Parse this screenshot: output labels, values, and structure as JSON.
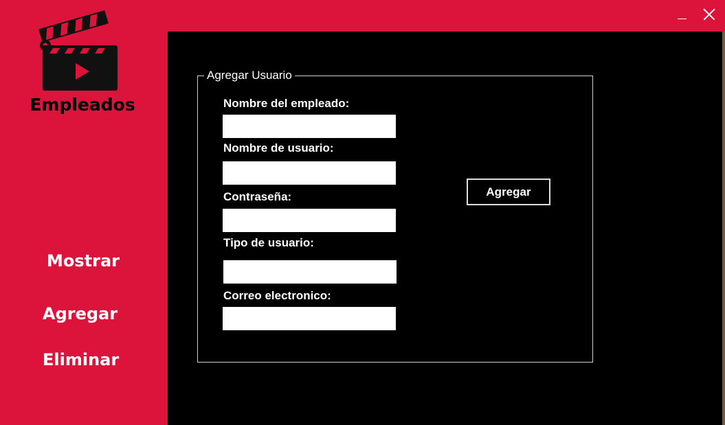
{
  "window": {
    "minimize_icon": "minimize-icon",
    "close_icon": "close-icon",
    "accent_color": "#dc143c",
    "content_bg": "#000000"
  },
  "sidebar": {
    "logo_icon": "clapperboard-play-icon",
    "app_title": "Empleados",
    "nav": [
      {
        "label": "Mostrar"
      },
      {
        "label": "Agregar"
      },
      {
        "label": "Eliminar"
      }
    ]
  },
  "form": {
    "group_title": "Agregar Usuario",
    "fields": [
      {
        "label": "Nombre del empleado:",
        "value": ""
      },
      {
        "label": "Nombre de usuario:",
        "value": ""
      },
      {
        "label": "Contraseña:",
        "value": ""
      },
      {
        "label": "Tipo de usuario:",
        "value": ""
      },
      {
        "label": "Correo electronico:",
        "value": ""
      }
    ],
    "submit_label": "Agregar"
  }
}
